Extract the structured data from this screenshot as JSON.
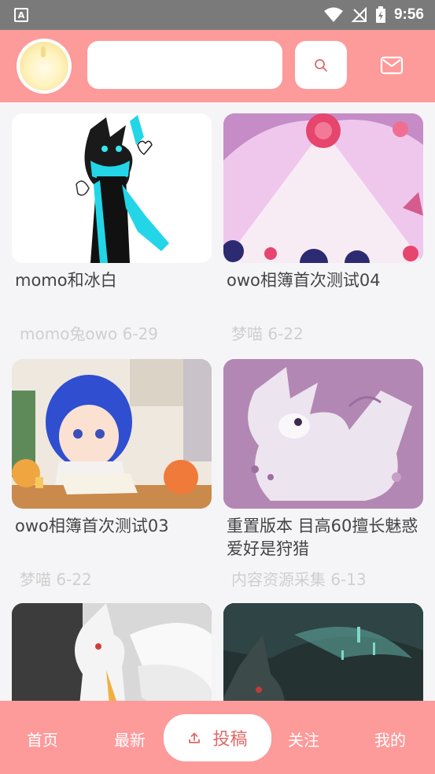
{
  "status_bar": {
    "time": "9:56",
    "notification_letter": "A"
  },
  "header": {
    "search_placeholder": "",
    "avatar": "user-avatar",
    "search_icon": "search-icon",
    "mail_icon": "mail-icon"
  },
  "cards": [
    {
      "title": "momo和冰白",
      "meta": "momo兔owo 6-29"
    },
    {
      "title": "owo相簿首次测试04",
      "meta": "梦喵 6-22"
    },
    {
      "title": "owo相簿首次测试03",
      "meta": "梦喵 6-22"
    },
    {
      "title": "重置版本 目高60擅长魅惑 爱好是狩猎",
      "meta": "内容资源采集 6-13"
    },
    {
      "title": "",
      "meta": ""
    },
    {
      "title": "",
      "meta": ""
    }
  ],
  "bottom_nav": {
    "home": "首页",
    "latest": "最新",
    "upload": "投稿",
    "follow": "关注",
    "mine": "我的"
  },
  "colors": {
    "accent": "#fd9a9a",
    "meta_text": "#cfcfcf",
    "title_text": "#444444"
  }
}
